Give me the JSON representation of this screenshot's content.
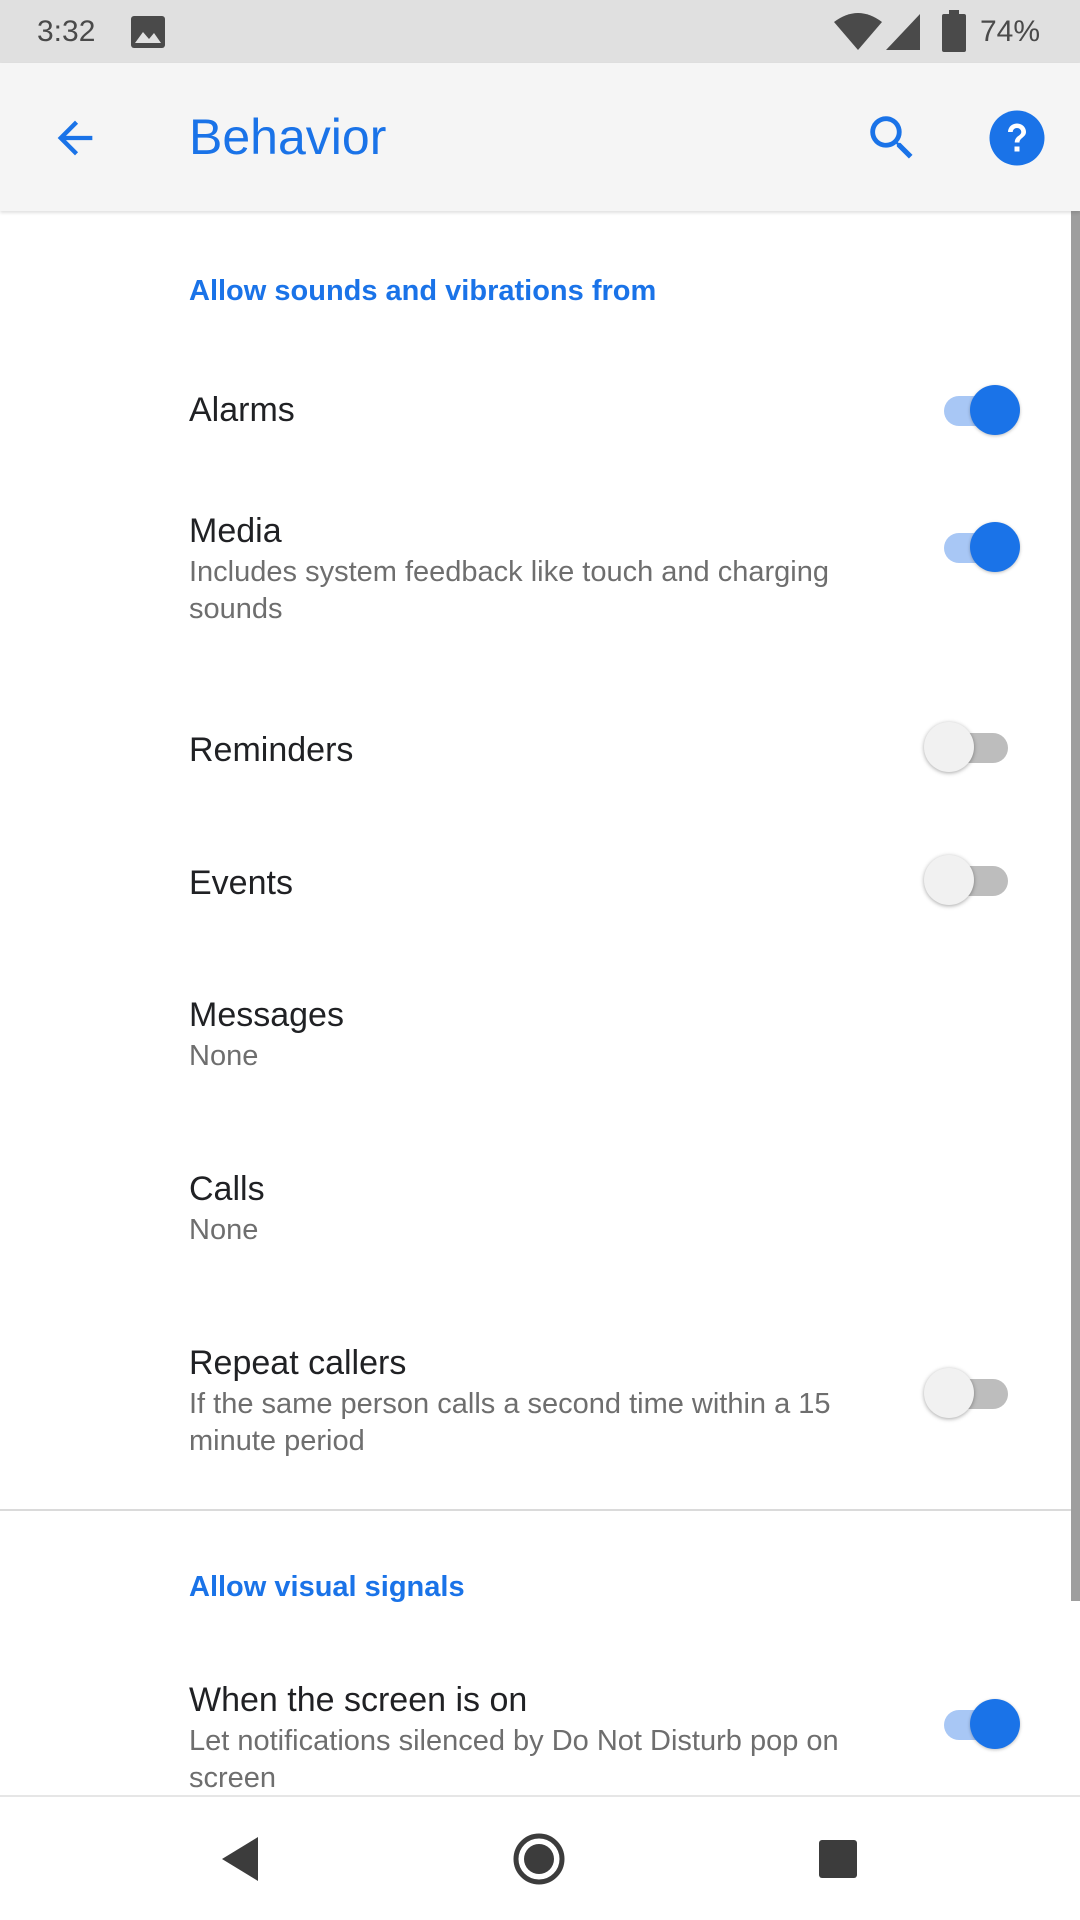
{
  "status_bar": {
    "time": "3:32",
    "battery": "74%",
    "icons": [
      "image-icon",
      "wifi-icon",
      "signal-icon",
      "battery-icon"
    ]
  },
  "app_bar": {
    "title": "Behavior",
    "icons": [
      "back-arrow-icon",
      "search-icon",
      "help-icon"
    ]
  },
  "sections": {
    "sounds": {
      "header": "Allow sounds and vibrations from",
      "alarms": {
        "title": "Alarms",
        "enabled": true
      },
      "media": {
        "title": "Media",
        "subtitle": "Includes system feedback like touch and charging sounds",
        "enabled": true
      },
      "reminders": {
        "title": "Reminders",
        "enabled": false
      },
      "events": {
        "title": "Events",
        "enabled": false
      },
      "messages": {
        "title": "Messages",
        "subtitle": "None"
      },
      "calls": {
        "title": "Calls",
        "subtitle": "None"
      },
      "repeat_callers": {
        "title": "Repeat callers",
        "subtitle": "If the same person calls a second time within a 15 minute period",
        "enabled": false
      }
    },
    "visual": {
      "header": "Allow visual signals",
      "screen_on": {
        "title": "When the screen is on",
        "subtitle": "Let notifications silenced by Do Not Disturb pop on screen",
        "enabled": true
      }
    }
  },
  "nav_bar": {
    "icons": [
      "nav-back-icon",
      "nav-home-icon",
      "nav-recents-icon"
    ]
  },
  "colors": {
    "accent": "#1a73e8",
    "track_on": "#a8c7f5",
    "status_bar_bg": "#e0e0e0",
    "app_bar_bg": "#f5f5f5"
  }
}
